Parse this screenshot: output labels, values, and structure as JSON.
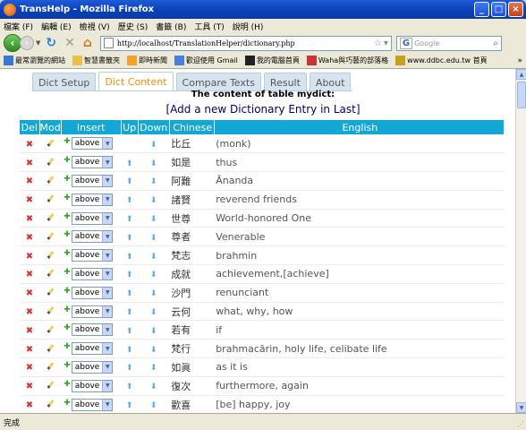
{
  "window": {
    "title": "TransHelp - Mozilla Firefox"
  },
  "menu": [
    "檔案 (F)",
    "編輯 (E)",
    "檢視 (V)",
    "歷史 (S)",
    "書籤 (B)",
    "工具 (T)",
    "說明 (H)"
  ],
  "nav": {
    "url": "http://localhost/TranslationHelper/dictionary.php",
    "search_placeholder": "Google"
  },
  "bookmarks": [
    "最常瀏覽的網站",
    "智慧書籤夾",
    "即時新聞",
    "歡迎使用 Gmail",
    "我的電腦首頁",
    "Waha與巧藝的部落格",
    "www.ddbc.edu.tw 首頁"
  ],
  "tabs": [
    "Dict Setup",
    "Dict Content",
    "Compare Texts",
    "Result",
    "About"
  ],
  "active_tab": "Dict Content",
  "heading": "The content of table mydict:",
  "add_link": "[Add a new Dictionary Entry in Last]",
  "columns": [
    "Del",
    "Mod",
    "Insert",
    "Up",
    "Down",
    "Chinese",
    "English"
  ],
  "insert_option": "above",
  "rows": [
    {
      "chinese": "比丘",
      "english": "(monk)"
    },
    {
      "chinese": "如是",
      "english": "thus"
    },
    {
      "chinese": "阿難",
      "english": "Ānanda"
    },
    {
      "chinese": "諸賢",
      "english": "reverend friends"
    },
    {
      "chinese": "世尊",
      "english": "World-honored One"
    },
    {
      "chinese": "尊者",
      "english": "Venerable"
    },
    {
      "chinese": "梵志",
      "english": "brahmin"
    },
    {
      "chinese": "成就",
      "english": "achievement,[achieve]"
    },
    {
      "chinese": "沙門",
      "english": "renunciant"
    },
    {
      "chinese": "云何",
      "english": "what, why, how"
    },
    {
      "chinese": "若有",
      "english": "if"
    },
    {
      "chinese": "梵行",
      "english": "brahmacārin, holy life, celibate life"
    },
    {
      "chinese": "如眞",
      "english": "as it is"
    },
    {
      "chinese": "復次",
      "english": "furthermore, again"
    },
    {
      "chinese": "歡喜",
      "english": "[be] happy, joy"
    }
  ],
  "status": "完成"
}
